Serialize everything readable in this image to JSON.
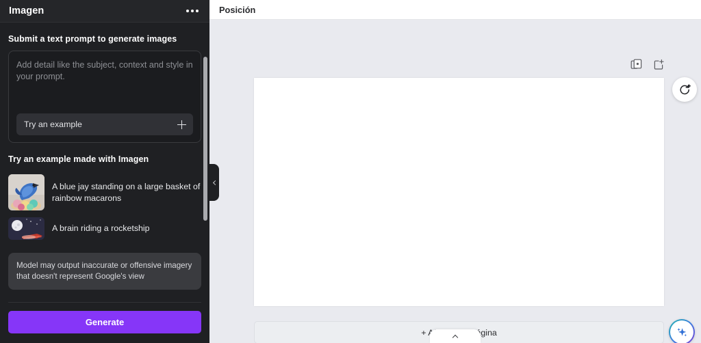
{
  "sidebar": {
    "title": "Imagen",
    "more_icon": "more-horizontal-icon",
    "prompt_section_title": "Submit a text prompt to generate images",
    "prompt": {
      "value": "",
      "placeholder": "Add detail like the subject, context and style in your prompt.",
      "chip_label": "Try an example",
      "chip_icon": "plus-icon"
    },
    "examples_title": "Try an example made with Imagen",
    "examples": [
      {
        "caption": "A blue jay standing on a large basket of rainbow macarons",
        "thumb": "blue-jay-macarons-thumb"
      },
      {
        "caption": "A brain riding a rocketship",
        "thumb": "brain-rocketship-thumb"
      }
    ],
    "disclaimer": "Model may output inaccurate or offensive imagery that doesn't represent Google's view",
    "generate_label": "Generate",
    "accent_color": "#8636f8",
    "background_color": "#1f2023",
    "collapse_icon": "chevron-left-icon"
  },
  "main": {
    "topbar": {
      "label": "Posición"
    },
    "page_tools": [
      {
        "name": "duplicate-page-icon",
        "label": "Duplicar página"
      },
      {
        "name": "add-page-icon",
        "label": "Añadir página"
      }
    ],
    "refresh_button": {
      "icon": "rotate-plus-icon"
    },
    "add_page_label": "+ Añadir una página",
    "magic_button": {
      "icon": "sparkle-icon"
    },
    "bottom_tab": {
      "icon": "chevron-up-icon"
    },
    "canvas_background": "#e9eaef",
    "page_background": "#ffffff"
  }
}
